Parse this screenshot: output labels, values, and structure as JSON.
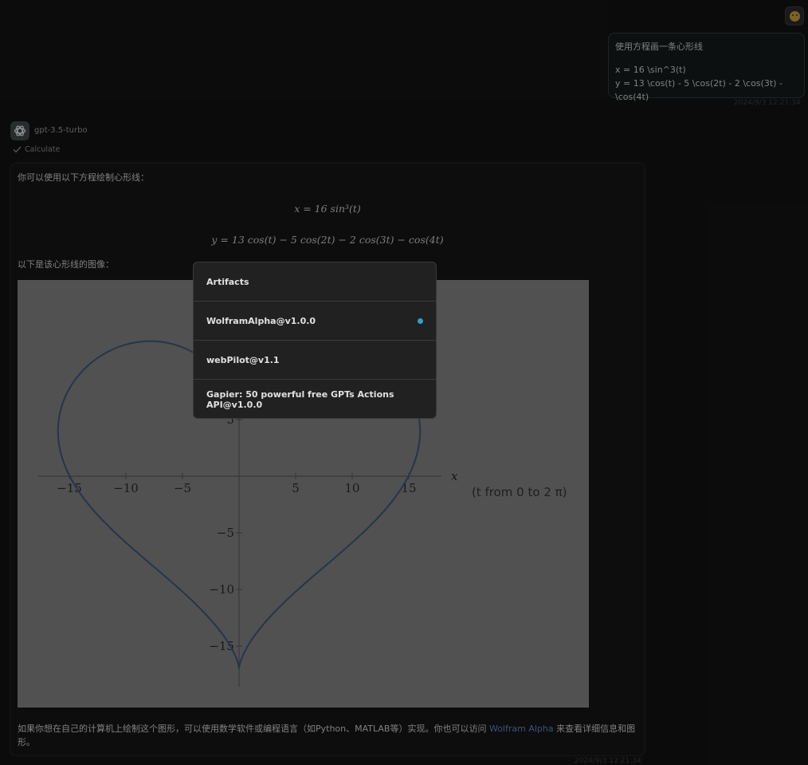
{
  "user": {
    "message_lines": [
      "使用方程画一条心形线",
      "",
      "x = 16 \\sin^3(t)",
      "y = 13 \\cos(t) - 5 \\cos(2t) - 2 \\cos(3t) - \\cos(4t)"
    ],
    "timestamp": "2024/9/3 12:21:34"
  },
  "assistant": {
    "model": "gpt-3.5-turbo",
    "tool_label": "Calculate",
    "intro": "你可以使用以下方程绘制心形线：",
    "eq1": "x = 16 sin³(t)",
    "eq2": "y = 13 cos(t) − 5 cos(2t) − 2 cos(3t) − cos(4t)",
    "image_intro": "以下是该心形线的图像：",
    "footer_before": "如果你想在自己的计算机上绘制这个图形，可以使用数学软件或编程语言（如Python、MATLAB等）实现。你也可以访问 ",
    "footer_link": "Wolfram Alpha",
    "footer_after": " 来查看详细信息和图形。",
    "timestamp": "2024/9/3 12:21:34"
  },
  "plot": {
    "x_axis_label": "x",
    "range_note": "(t  from 0 to 2 π)",
    "x_ticks": [
      "−15",
      "−10",
      "−5",
      "5",
      "10",
      "15"
    ],
    "y_ticks": [
      "5",
      "−5",
      "−10",
      "−15"
    ]
  },
  "chart_data": {
    "type": "line",
    "title": "",
    "xlabel": "x",
    "ylabel": "",
    "parametric": {
      "x": "16 sin^3(t)",
      "y": "13 cos(t) - 5 cos(2t) - 2 cos(3t) - cos(4t)",
      "t_range": [
        0,
        6.283185307
      ]
    },
    "x_ticks": [
      -15,
      -10,
      -5,
      5,
      10,
      15
    ],
    "y_ticks": [
      5,
      -5,
      -10,
      -15
    ],
    "series": [
      {
        "color": "#3f5579"
      }
    ]
  },
  "menu": {
    "items": [
      {
        "label": "Artifacts",
        "selected": false
      },
      {
        "label": "WolframAlpha@v1.0.0",
        "selected": true
      },
      {
        "label": "webPilot@v1.1",
        "selected": false
      },
      {
        "label": "Gapier: 50 powerful free GPTs Actions API@v1.0.0",
        "selected": false
      }
    ]
  },
  "colors": {
    "accent_dot": "#2aa3c4",
    "link": "#5d87c9",
    "curve": "#3f5579"
  }
}
